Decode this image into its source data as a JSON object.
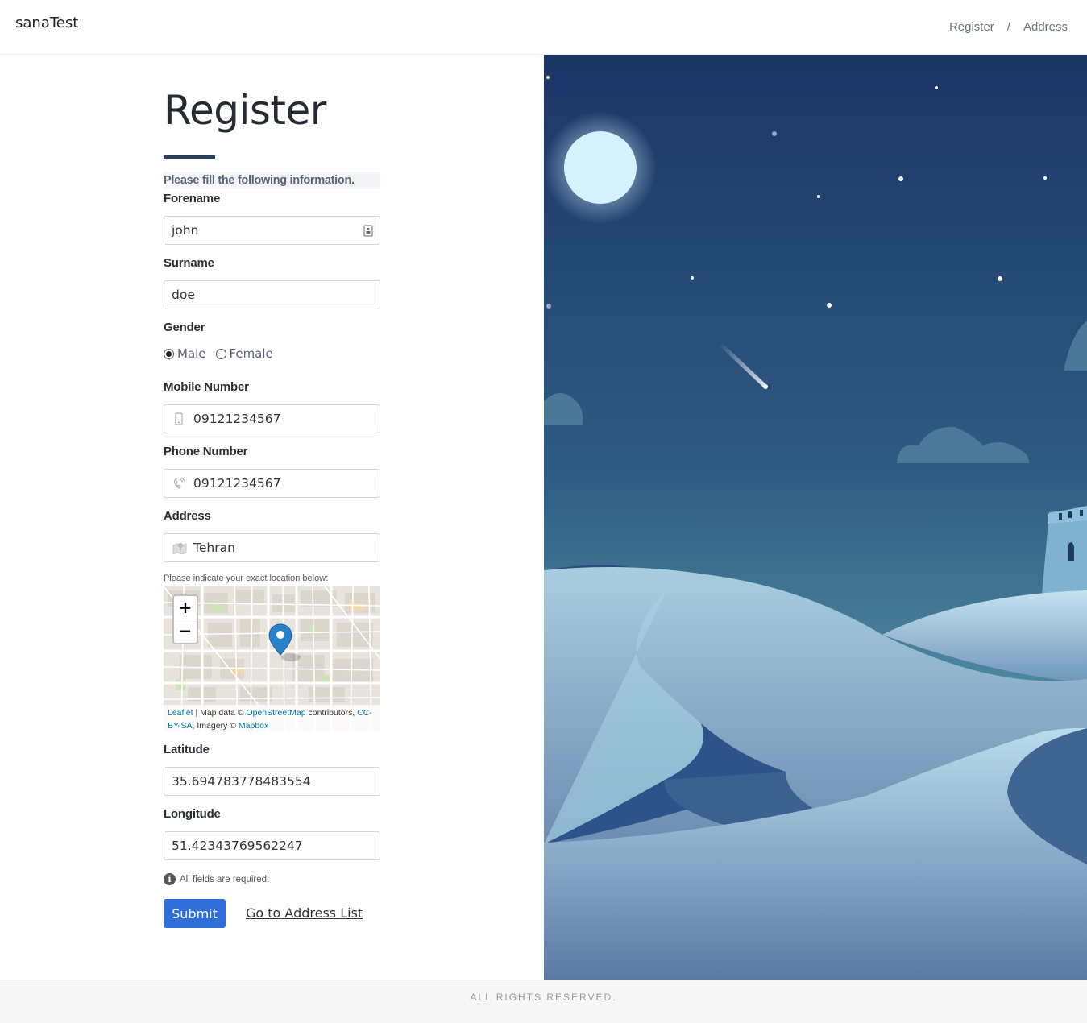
{
  "header": {
    "brand": "sanaTest",
    "breadcrumb": [
      "Register",
      "Address"
    ],
    "separator": "/"
  },
  "form": {
    "title": "Register",
    "intro": "Please fill the following information.",
    "forename": {
      "label": "Forename",
      "value": "john"
    },
    "surname": {
      "label": "Surname",
      "value": "doe"
    },
    "gender": {
      "label": "Gender",
      "options": [
        "Male",
        "Female"
      ],
      "selected": "Male"
    },
    "mobile": {
      "label": "Mobile Number",
      "value": "09121234567"
    },
    "phone": {
      "label": "Phone Number",
      "value": "09121234567"
    },
    "address": {
      "label": "Address",
      "value": "Tehran"
    },
    "location_hint": "Please indicate your exact location below:",
    "latitude": {
      "label": "Latitude",
      "value": "35.694783778483554"
    },
    "longitude": {
      "label": "Longitude",
      "value": "51.42343769562247"
    },
    "required_note": "All fields are required!",
    "submit": "Submit",
    "goto_list": "Go to Address List"
  },
  "map": {
    "zoom_in": "+",
    "zoom_out": "−",
    "attribution": {
      "leaflet": "Leaflet",
      "sep": " | Map data © ",
      "osm": "OpenStreetMap",
      "contrib": " contributors, ",
      "license": "CC-BY-SA",
      "imagery": ", Imagery © ",
      "mapbox": "Mapbox"
    }
  },
  "footer": {
    "text": "ALL RIGHTS RESERVED."
  },
  "colors": {
    "primary": "#2f6ed8",
    "sky_top": "#1b3566",
    "sky_bottom": "#4f8ba0",
    "moon": "#d4f1fc"
  }
}
